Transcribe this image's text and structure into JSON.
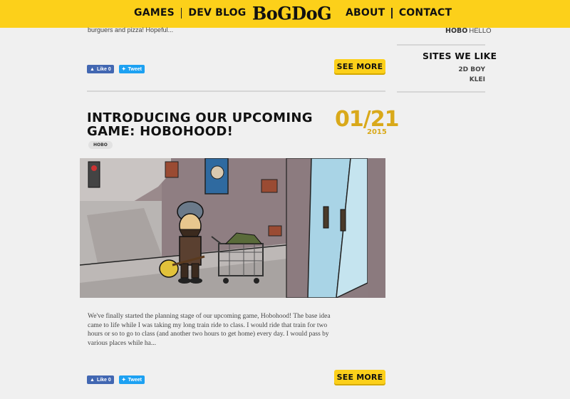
{
  "header": {
    "nav_left": [
      "GAMES",
      "DEV BLOG"
    ],
    "logo": "BoGDoG",
    "nav_right": [
      "ABOUT",
      "CONTACT"
    ]
  },
  "previous_post": {
    "excerpt_tail": "burguers and pizza! Hopeful...",
    "like_label": "Like 0",
    "tweet_label": "Tweet",
    "see_more_label": "SEE MORE"
  },
  "post": {
    "title": "INTRODUCING OUR UPCOMING GAME: HOBOHOOD!",
    "date": "01/21",
    "year": "2015",
    "tag": "HOBO",
    "excerpt": "We've finally started the planning stage of our upcoming game, Hobohood! The base idea came to life while I was taking my long train ride to class. I would ride that train for two hours or so to go to class (and another two hours to get home) every day. I would pass by various places while ha...",
    "like_label": "Like 0",
    "tweet_label": "Tweet",
    "see_more_label": "SEE MORE"
  },
  "sidebar": {
    "tags": [
      {
        "label": "HOBO"
      },
      {
        "label": "HELLO"
      }
    ],
    "sites_heading": "SITES WE LIKE",
    "sites": [
      "2D BOY",
      "KLEI"
    ]
  },
  "colors": {
    "brand_yellow": "#fcd01a",
    "date_gold": "#d9a91a",
    "facebook_blue": "#4267b2",
    "twitter_blue": "#1da1f2"
  }
}
